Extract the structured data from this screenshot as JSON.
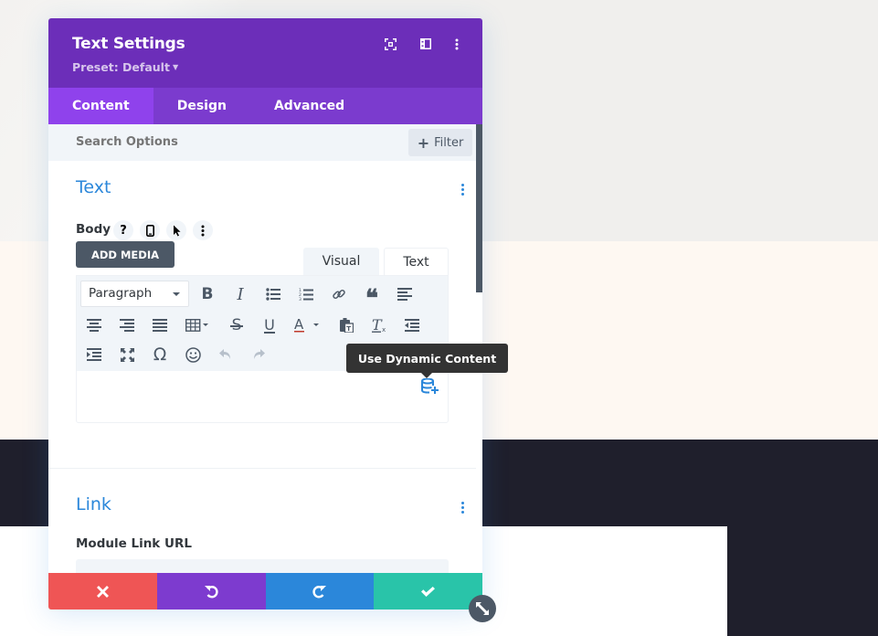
{
  "modal": {
    "title": "Text Settings",
    "preset_label": "Preset: Default",
    "header_icons": [
      "expand-icon",
      "sidebar-layout-icon",
      "more-vertical-icon"
    ]
  },
  "tabs": [
    {
      "label": "Content",
      "active": true
    },
    {
      "label": "Design",
      "active": false
    },
    {
      "label": "Advanced",
      "active": false
    }
  ],
  "search": {
    "placeholder": "Search Options",
    "value": "",
    "filter_label": "Filter"
  },
  "sections": {
    "text": {
      "title": "Text",
      "body_label": "Body",
      "body_option_icons": [
        "help-icon",
        "mobile-icon",
        "pointer-icon",
        "more-vertical-icon"
      ],
      "add_media_label": "ADD MEDIA",
      "editor_tabs": [
        {
          "label": "Visual",
          "active": true
        },
        {
          "label": "Text",
          "active": false
        }
      ],
      "format_select": "Paragraph",
      "toolbar_row1": [
        "bold",
        "italic",
        "bullet-list",
        "numbered-list",
        "link",
        "blockquote",
        "align-left"
      ],
      "toolbar_row2": [
        "align-center",
        "align-right",
        "align-justify",
        "table",
        "strikethrough",
        "underline",
        "text-color",
        "paste-as-text",
        "clear-formatting",
        "outdent"
      ],
      "toolbar_row3": [
        "indent",
        "fullscreen",
        "special-character",
        "emoticons",
        "undo",
        "redo"
      ],
      "editor_content": ""
    },
    "link": {
      "title": "Link",
      "url_label": "Module Link URL",
      "url_value": ""
    }
  },
  "tooltip": {
    "text": "Use Dynamic Content"
  },
  "footer": {
    "buttons": [
      "cancel",
      "undo",
      "redo",
      "save"
    ],
    "colors": {
      "cancel": "#ef5555",
      "undo": "#7d3bcf",
      "redo": "#2b87da",
      "save": "#29c4a9"
    }
  },
  "colors": {
    "header": "#6c2eb9",
    "tabs_bar": "#7b3bce",
    "active_tab": "#8f42ec",
    "accent_blue": "#2b87da",
    "dark_gray": "#4c5866"
  }
}
